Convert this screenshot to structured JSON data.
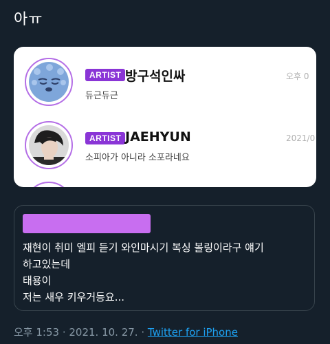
{
  "tweet": {
    "text": "아ㅠ"
  },
  "screenshot": {
    "rows": [
      {
        "badge": "ARTIST",
        "name": "방구석인싸",
        "message": "듀근듀근",
        "time": "오후 0"
      },
      {
        "badge": "ARTIST",
        "name": "JAEHYUN",
        "message": "소피아가 아니라 소포라네요",
        "time": "2021/0"
      }
    ],
    "colors": {
      "badge": "#8a35d6",
      "ring": "#b46ee6"
    }
  },
  "quote": {
    "lines": [
      "재현이 취미 엘피 듣기 와인마시기 복싱 볼링이라구 얘기",
      "하고있는데",
      "태용이",
      "저는 새우 키우거등요..."
    ],
    "redaction_color": "#c86ef0"
  },
  "meta": {
    "time": "오후 1:53",
    "sep1": " · ",
    "date": "2021. 10. 27.",
    "sep2": " · ",
    "source": "Twitter for iPhone"
  }
}
